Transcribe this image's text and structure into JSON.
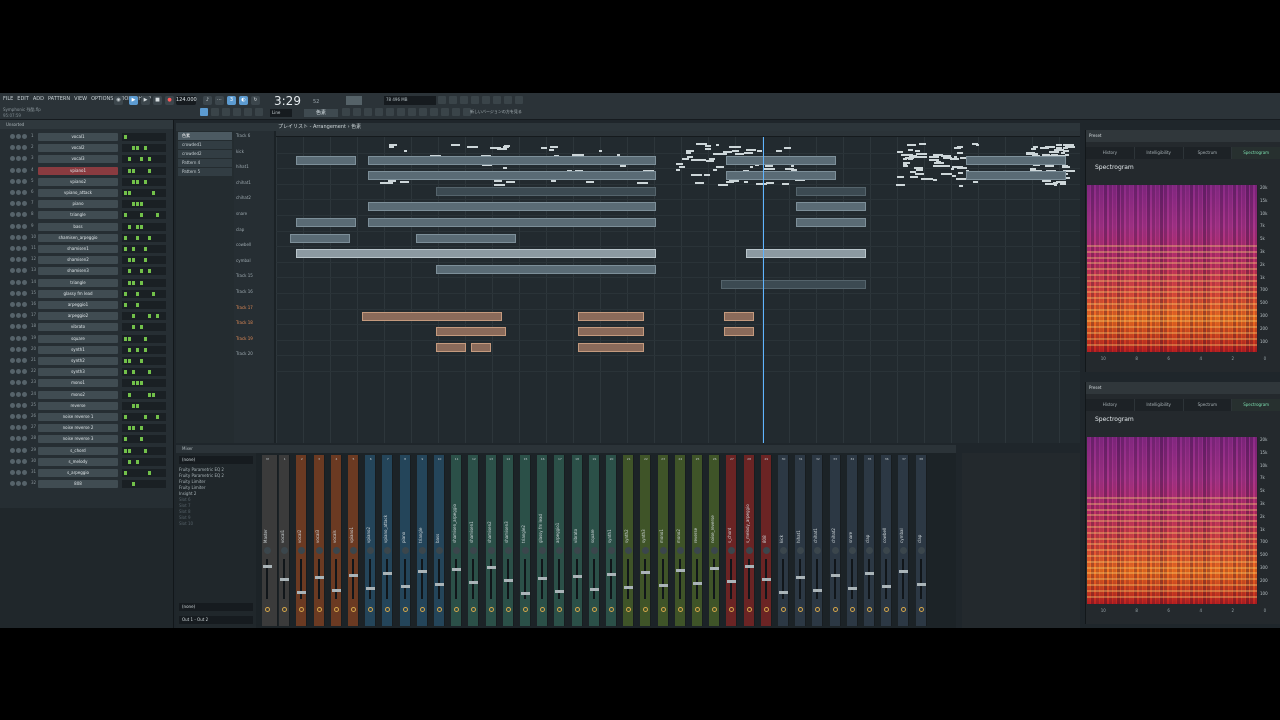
{
  "menu": [
    "FILE",
    "EDIT",
    "ADD",
    "PATTERN",
    "VIEW",
    "OPTIONS",
    "TOOLS",
    "HELP"
  ],
  "file_name": "Symphonic 残酷.flp",
  "status_left": "95:07:59",
  "track_hint": "Track 16",
  "tempo": "124.000",
  "song_time": "3:29",
  "song_time_sub": "52",
  "cpu_text": "78  496 MB",
  "snap": "Line",
  "pattern_selector": "色素",
  "hint_text": "新しいバージョンの方を見る",
  "playlist_title": "プレイリスト - Arrangement › 色素",
  "rack_filter": "Unsorted",
  "channels": [
    {
      "n": "1",
      "name": "vocal1"
    },
    {
      "n": "2",
      "name": "vocal2"
    },
    {
      "n": "3",
      "name": "vocal3"
    },
    {
      "n": "4",
      "name": "vpiano1"
    },
    {
      "n": "5",
      "name": "vpiano2"
    },
    {
      "n": "6",
      "name": "vpiano_attack"
    },
    {
      "n": "7",
      "name": "piano"
    },
    {
      "n": "8",
      "name": "triangle"
    },
    {
      "n": "9",
      "name": "bass"
    },
    {
      "n": "10",
      "name": "shamisen_arpeggio"
    },
    {
      "n": "11",
      "name": "shamisen1"
    },
    {
      "n": "12",
      "name": "shamisen2"
    },
    {
      "n": "13",
      "name": "shamisen3"
    },
    {
      "n": "14",
      "name": "triangle"
    },
    {
      "n": "15",
      "name": "glassy fm lead"
    },
    {
      "n": "16",
      "name": "arpeggio1"
    },
    {
      "n": "17",
      "name": "arpeggio2"
    },
    {
      "n": "18",
      "name": "vibrato"
    },
    {
      "n": "19",
      "name": "square"
    },
    {
      "n": "20",
      "name": "synth1"
    },
    {
      "n": "21",
      "name": "synth2"
    },
    {
      "n": "22",
      "name": "synth3"
    },
    {
      "n": "23",
      "name": "mono1"
    },
    {
      "n": "24",
      "name": "mono2"
    },
    {
      "n": "25",
      "name": "reverse"
    },
    {
      "n": "26",
      "name": "noise reverse 1"
    },
    {
      "n": "27",
      "name": "noise reverse 2"
    },
    {
      "n": "28",
      "name": "noise reverse 3"
    },
    {
      "n": "29",
      "name": "s_chord"
    },
    {
      "n": "30",
      "name": "s_melody"
    },
    {
      "n": "31",
      "name": "s_arpeggio"
    },
    {
      "n": "32",
      "name": "808"
    }
  ],
  "patterns": [
    "色素",
    "crowded1",
    "crowded2",
    "Pattern 4",
    "Pattern 5"
  ],
  "tracks": [
    {
      "name": "Track 6",
      "color": "grey"
    },
    {
      "name": "kick",
      "color": "grey"
    },
    {
      "name": "hihat1",
      "color": "grey"
    },
    {
      "name": "chihat1",
      "color": "grey"
    },
    {
      "name": "chihat2",
      "color": "grey"
    },
    {
      "name": "snare",
      "color": "grey"
    },
    {
      "name": "clap",
      "color": "grey"
    },
    {
      "name": "cowbell",
      "color": "grey"
    },
    {
      "name": "cymbal",
      "color": "grey"
    },
    {
      "name": "Track 15",
      "color": "grey"
    },
    {
      "name": "Track 16",
      "color": "grey"
    },
    {
      "name": "Track 17",
      "color": "orange"
    },
    {
      "name": "Track 18",
      "color": "orange"
    },
    {
      "name": "Track 19",
      "color": "orange"
    },
    {
      "name": "Track 20",
      "color": "grey"
    }
  ],
  "mixer_title": "Mixer",
  "mixer_preset": "(none)",
  "mixer_fx": [
    "Fruity Parametric EQ 2",
    "Fruity Parametric EQ 2",
    "Fruity Limiter",
    "Fruity Limiter",
    "Insight 2",
    "Slot 6",
    "Slot 7",
    "Slot 8",
    "Slot 9",
    "Slot 10"
  ],
  "mixer_input": "(none)",
  "mixer_output": "Out 1 - Out 2",
  "mixer_strips": [
    "Master",
    "vocal1",
    "vocal2",
    "vocal3",
    "vocals",
    "vpiano1",
    "vpiano2",
    "vpiano_attack",
    "piano",
    "triangle",
    "bass",
    "shamisen_arpeggio",
    "shamisen1",
    "shamisen2",
    "shamisen3",
    "triangle2",
    "glassy fm lead",
    "arpeggio1",
    "vibrato",
    "square",
    "synth1",
    "synth2",
    "synth3",
    "mono1",
    "mono2",
    "reverse",
    "noise_reverse",
    "s_chord",
    "s_melody_arpeggio",
    "808",
    "kick",
    "hihat1",
    "chihat1",
    "chihat2",
    "snare",
    "clap",
    "cowbell",
    "cymbal",
    "clap"
  ],
  "plugins": [
    {
      "preset": "Preset",
      "tabs": [
        "History",
        "Intelligibility",
        "Spectrum",
        "Spectrogram"
      ],
      "active": "Spectrogram",
      "title": "Spectrogram",
      "axis": [
        "20k",
        "15k",
        "10k",
        "7k",
        "5k",
        "3k",
        "2k",
        "1k",
        "700",
        "500",
        "300",
        "200",
        "100"
      ],
      "foot": [
        "10",
        "8",
        "6",
        "4",
        "2",
        "0"
      ]
    },
    {
      "preset": "Preset",
      "tabs": [
        "History",
        "Intelligibility",
        "Spectrum",
        "Spectrogram"
      ],
      "active": "Spectrogram",
      "title": "Spectrogram",
      "axis": [
        "20k",
        "15k",
        "10k",
        "7k",
        "5k",
        "3k",
        "2k",
        "1k",
        "700",
        "500",
        "300",
        "200",
        "100"
      ],
      "foot": [
        "10",
        "8",
        "6",
        "4",
        "2",
        "0"
      ]
    }
  ],
  "colors": {
    "accent": "#5c9bd1",
    "selected_channel": "#8a3b40",
    "active_tab": "#7de0b0",
    "playhead": "#5fb4ff"
  }
}
